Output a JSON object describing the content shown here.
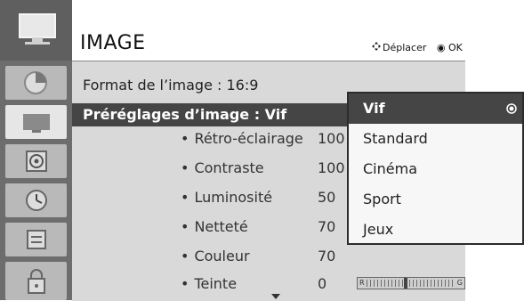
{
  "header": {
    "title": "IMAGE",
    "hint_move": "Déplacer",
    "hint_ok": "OK"
  },
  "rail": {
    "icons": [
      "tv-icon",
      "picture-icon",
      "audio-icon",
      "time-icon",
      "option-icon",
      "lock-icon"
    ]
  },
  "menu": {
    "format_label": "Format de l’image",
    "format_value": ": 16:9",
    "presets_label": "Préréglages d’image : Vif",
    "settings": [
      {
        "label": "Rétro-éclairage",
        "value": "100"
      },
      {
        "label": "Contraste",
        "value": "100"
      },
      {
        "label": "Luminosité",
        "value": "50"
      },
      {
        "label": "Netteté",
        "value": "70"
      },
      {
        "label": "Couleur",
        "value": "70"
      },
      {
        "label": "Teinte",
        "value": "0"
      }
    ],
    "tint_slider": {
      "left_label": "R",
      "right_label": "G"
    }
  },
  "dropdown": {
    "options": [
      "Vif",
      "Standard",
      "Cinéma",
      "Sport",
      "Jeux"
    ],
    "selected": "Vif"
  },
  "colors": {
    "rail_bg": "#6d6d6d",
    "panel_bg": "#d9d9d9",
    "selected_bg": "#454545"
  }
}
